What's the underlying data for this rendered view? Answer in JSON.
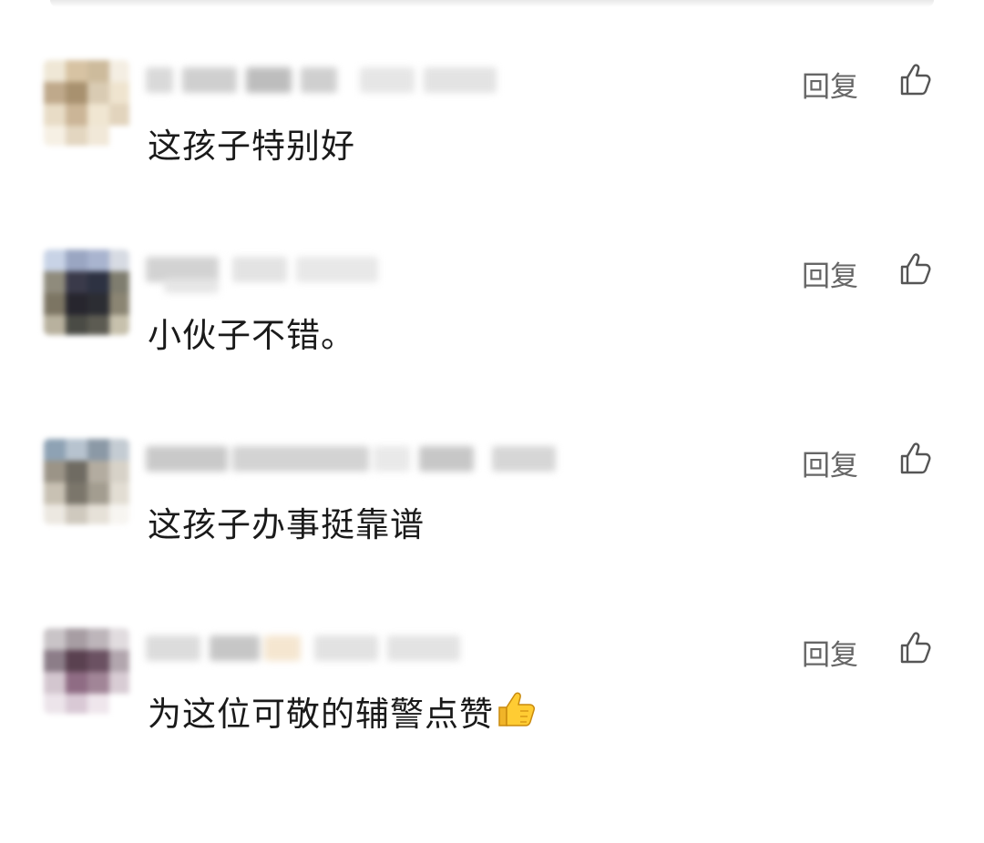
{
  "comments": [
    {
      "text": "这孩子特别好",
      "reply_label": "回复",
      "like_icon": "thumb-up-outline-icon",
      "username_hidden": true,
      "avatar_colors": [
        "#efe7d6",
        "#d7c3a3",
        "#cdbb9c",
        "#f4eee3",
        "#bfa98b",
        "#a8916f",
        "#d9cbb3",
        "#efe4cf",
        "#e8dcc6",
        "#cbb597",
        "#f0e6d2",
        "#e2d4bd",
        "#f6f0e4",
        "#e3d6c0",
        "#f1e8d8",
        "#ffffff"
      ]
    },
    {
      "text": "小伙子不错。",
      "reply_label": "回复",
      "like_icon": "thumb-up-outline-icon",
      "username_hidden": true,
      "avatar_colors": [
        "#c8d3e6",
        "#9aa6c2",
        "#a9b4cf",
        "#d7dbe3",
        "#8f8b7c",
        "#3a3a4a",
        "#2d3242",
        "#7f7d6f",
        "#7c7563",
        "#27262e",
        "#2c2d33",
        "#8b8573",
        "#b8b19e",
        "#4a4b45",
        "#5c5b52",
        "#c7c1ad"
      ]
    },
    {
      "text": "这孩子办事挺靠谱",
      "reply_label": "回复",
      "like_icon": "thumb-up-outline-icon",
      "username_hidden": true,
      "avatar_colors": [
        "#8ea2b4",
        "#b7c3cf",
        "#8b99a6",
        "#c4ccd3",
        "#9b9487",
        "#6f6b62",
        "#b3aca0",
        "#d7d2c8",
        "#c8c1b3",
        "#7b766b",
        "#a39d90",
        "#e2ddd3",
        "#ece8e1",
        "#cfc9be",
        "#e6e1d8",
        "#f7f5f1"
      ]
    },
    {
      "text": "为这位可敬的辅警点赞",
      "emoji": "👍",
      "reply_label": "回复",
      "like_icon": "thumb-up-outline-icon",
      "username_hidden": true,
      "avatar_colors": [
        "#c9c4c7",
        "#a79da3",
        "#bdb5ba",
        "#e1dcdf",
        "#8c7d88",
        "#5a4150",
        "#6b5162",
        "#b2a6ae",
        "#d3c6cf",
        "#8f6c84",
        "#a18597",
        "#d8ccd4",
        "#ece4ea",
        "#d9c9d5",
        "#efe6ec",
        "#ffffff"
      ]
    }
  ],
  "colors": {
    "background": "#ffffff",
    "text": "#1a1a1a",
    "secondary_text": "#666666"
  }
}
